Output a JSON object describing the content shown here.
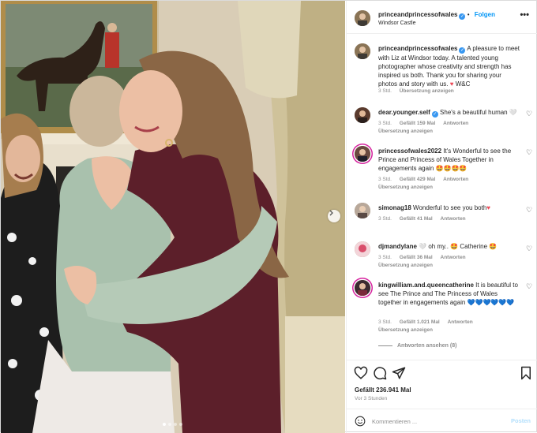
{
  "header": {
    "username": "princeandprincessofwales",
    "follow_label": "Folgen",
    "location": "Windsor Castle",
    "more_glyph": "•••"
  },
  "caption": {
    "username": "princeandprincessofwales",
    "text": "A pleasure to meet with Liz at Windsor today. A talented young photographer whose creativity and strength has inspired us both. Thank you for sharing your photos and story with us.",
    "signoff": "W&C",
    "time": "3 Std.",
    "translate": "Übersetzung anzeigen"
  },
  "comments": [
    {
      "username": "dear.younger.self",
      "text": "She's a beautiful human 🤍",
      "time": "3 Std.",
      "likes": "Gefällt 159 Mal",
      "reply": "Antworten",
      "translate": "Übersetzung anzeigen"
    },
    {
      "username": "princessofwales2022",
      "text": "It's Wonderful to see the Prince and Princess of Wales Together in engagements again",
      "emoji": "🤩🤩🤩🤩",
      "time": "3 Std.",
      "likes": "Gefällt 429 Mal",
      "reply": "Antworten",
      "translate": "Übersetzung anzeigen"
    },
    {
      "username": "simonag18",
      "text": "Wonderful to see you both",
      "emoji": "♥",
      "time": "3 Std.",
      "likes": "Gefällt 41 Mal",
      "reply": "Antworten"
    },
    {
      "username": "djmandylane",
      "text": "🤍 oh my.. 🤩 Catherine 🤩",
      "time": "3 Std.",
      "likes": "Gefällt 36 Mal",
      "reply": "Antworten",
      "translate": "Übersetzung anzeigen"
    },
    {
      "username": "kingwilliam.and.queencatherine",
      "text": "It is beautiful to see The Prince and The Princess of Wales together in engagements again",
      "emoji": "💙💙💙💙💙💙",
      "time": "3 Std.",
      "likes": "Gefällt 1.021 Mal",
      "reply": "Antworten",
      "translate": "Übersetzung anzeigen"
    }
  ],
  "view_replies": "Antworten ansehen (8)",
  "likes_total": "Gefällt 236.941 Mal",
  "posted_time": "Vor 3 Stunden",
  "add_comment": {
    "placeholder": "Kommentieren ...",
    "post_label": "Posten"
  },
  "colors": {
    "accent": "#0095f6",
    "verified": "#3897f0",
    "heart": "#ed4956",
    "muted": "#8e8e8e"
  },
  "icons": [
    "heart-icon",
    "comment-icon",
    "share-icon",
    "bookmark-icon",
    "emoji-icon",
    "verified-icon",
    "chevron-right-icon",
    "more-icon"
  ]
}
